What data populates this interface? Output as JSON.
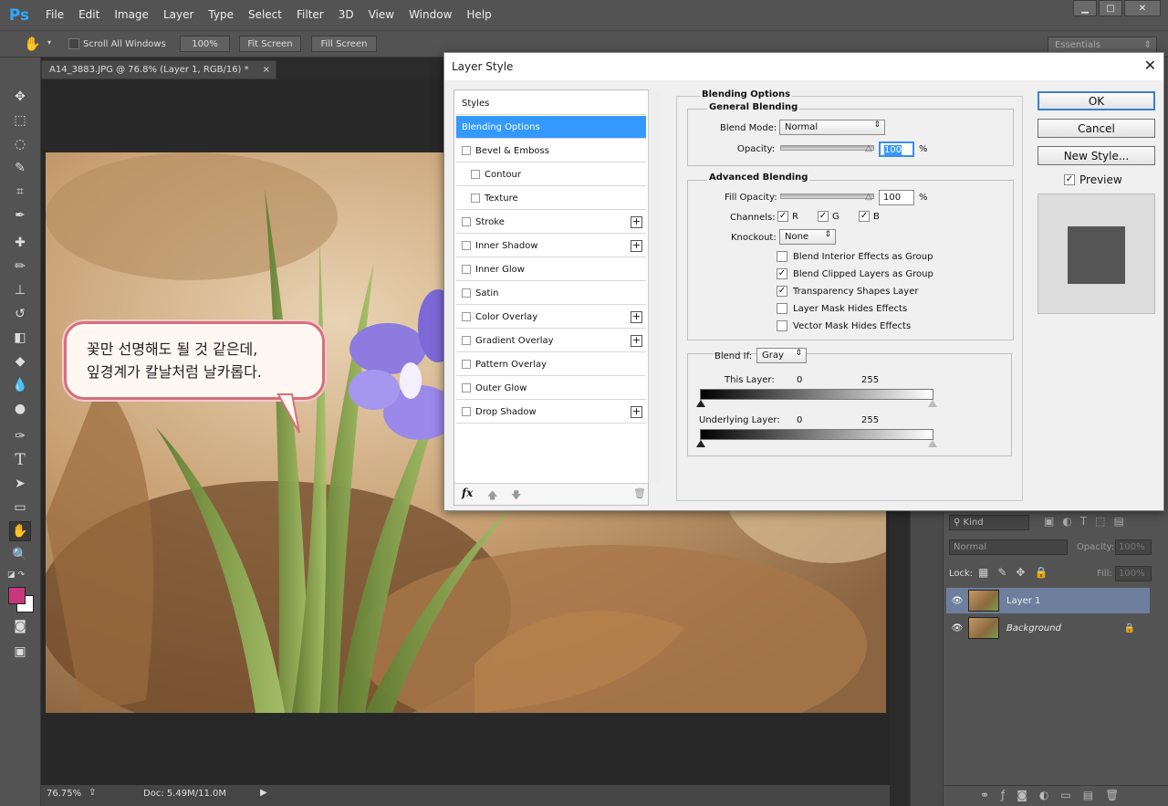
{
  "app": {
    "logo": "Ps"
  },
  "menu": [
    "File",
    "Edit",
    "Image",
    "Layer",
    "Type",
    "Select",
    "Filter",
    "3D",
    "View",
    "Window",
    "Help"
  ],
  "window_controls": {
    "minimize": "▁",
    "maximize": "□",
    "close": "✕"
  },
  "options": {
    "scroll_all": "Scroll All Windows",
    "zoom100": "100%",
    "fit": "Fit Screen",
    "fill": "Fill Screen",
    "workspace": "Essentials"
  },
  "document": {
    "tab_title": "A14_3883.JPG @ 76.8% (Layer 1, RGB/16) *",
    "close": "×"
  },
  "status": {
    "zoom": "76.75%",
    "doc": "Doc: 5.49M/11.0M"
  },
  "bubble": {
    "line1": "꽃만 선명해도 될 것 같은데,",
    "line2": "잎경계가 칼날처럼 날카롭다."
  },
  "layers": {
    "kind": "Kind",
    "blend": "Normal",
    "opacity_label": "Opacity:",
    "opacity": "100%",
    "lock_label": "Lock:",
    "fill_label": "Fill:",
    "fill": "100%",
    "items": [
      {
        "name": "Layer 1"
      },
      {
        "name": "Background"
      }
    ]
  },
  "dialog": {
    "title": "Layer Style",
    "styles_header": "Styles",
    "style_items": [
      {
        "label": "Blending Options",
        "selected": true,
        "checkbox": false,
        "plus": false
      },
      {
        "label": "Bevel & Emboss",
        "checkbox": true,
        "plus": false
      },
      {
        "label": "Contour",
        "checkbox": true,
        "plus": false,
        "indent": true
      },
      {
        "label": "Texture",
        "checkbox": true,
        "plus": false,
        "indent": true
      },
      {
        "label": "Stroke",
        "checkbox": true,
        "plus": true
      },
      {
        "label": "Inner Shadow",
        "checkbox": true,
        "plus": true
      },
      {
        "label": "Inner Glow",
        "checkbox": true,
        "plus": false
      },
      {
        "label": "Satin",
        "checkbox": true,
        "plus": false
      },
      {
        "label": "Color Overlay",
        "checkbox": true,
        "plus": true
      },
      {
        "label": "Gradient Overlay",
        "checkbox": true,
        "plus": true
      },
      {
        "label": "Pattern Overlay",
        "checkbox": true,
        "plus": false
      },
      {
        "label": "Outer Glow",
        "checkbox": true,
        "plus": false
      },
      {
        "label": "Drop Shadow",
        "checkbox": true,
        "plus": true
      }
    ],
    "fx": "fx",
    "blending_options": "Blending Options",
    "general_blending": "General Blending",
    "blend_mode_label": "Blend Mode:",
    "blend_mode": "Normal",
    "opacity_label": "Opacity:",
    "opacity": "100",
    "percent": "%",
    "advanced_blending": "Advanced Blending",
    "fill_opacity_label": "Fill Opacity:",
    "fill_opacity": "100",
    "channels_label": "Channels:",
    "channels": [
      "R",
      "G",
      "B"
    ],
    "knockout_label": "Knockout:",
    "knockout": "None",
    "options": [
      {
        "label": "Blend Interior Effects as Group",
        "checked": false
      },
      {
        "label": "Blend Clipped Layers as Group",
        "checked": true
      },
      {
        "label": "Transparency Shapes Layer",
        "checked": true
      },
      {
        "label": "Layer Mask Hides Effects",
        "checked": false
      },
      {
        "label": "Vector Mask Hides Effects",
        "checked": false
      }
    ],
    "blend_if_label": "Blend If:",
    "blend_if": "Gray",
    "this_layer": "This Layer:",
    "underlying_layer": "Underlying Layer:",
    "range_min": "0",
    "range_max": "255",
    "ok": "OK",
    "cancel": "Cancel",
    "new_style": "New Style...",
    "preview": "Preview"
  }
}
